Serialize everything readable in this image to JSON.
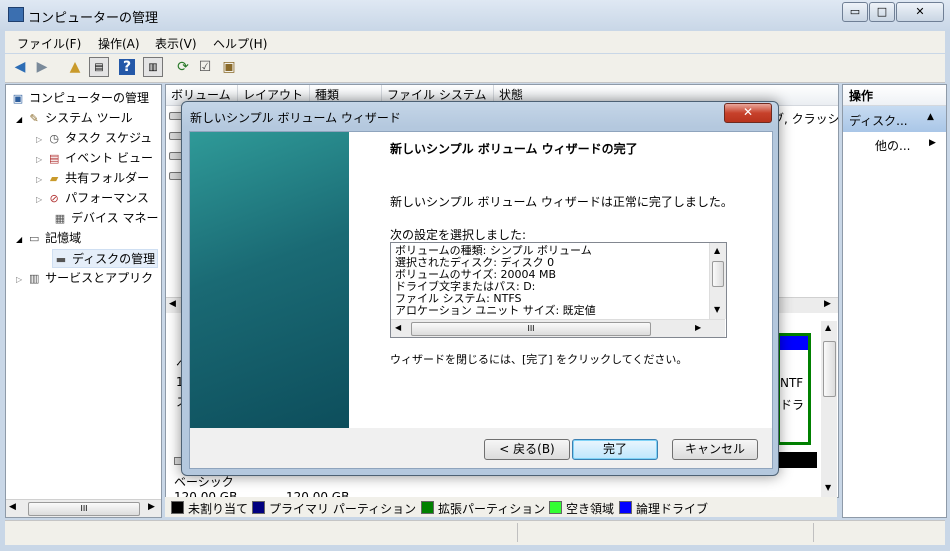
{
  "app": {
    "title": "コンピューターの管理",
    "window_buttons": {
      "minimize": "▭",
      "restore": "□",
      "close": "✕"
    }
  },
  "menu": [
    "ファイル(F)",
    "操作(A)",
    "表示(V)",
    "ヘルプ(H)"
  ],
  "tree": [
    {
      "label": "コンピューターの管理",
      "icon": "computer-icon"
    },
    {
      "label": "システム ツール",
      "icon": "tools-icon"
    },
    {
      "label": "タスク スケジュ",
      "icon": "clock-icon"
    },
    {
      "label": "イベント ビュー",
      "icon": "event-log-icon"
    },
    {
      "label": "共有フォルダー",
      "icon": "shared-folder-icon"
    },
    {
      "label": "パフォーマンス",
      "icon": "performance-icon"
    },
    {
      "label": "デバイス マネー",
      "icon": "device-manager-icon"
    },
    {
      "label": "記憶域",
      "icon": "storage-icon"
    },
    {
      "label": "ディスクの管理",
      "icon": "disk-icon"
    },
    {
      "label": "サービスとアプリク",
      "icon": "services-icon"
    }
  ],
  "center": {
    "columns": [
      "ボリューム",
      "レイアウト",
      "種類",
      "ファイル システム",
      "状態"
    ],
    "row_tail": "ブ, クラッシ",
    "disk_label": "ベーシック",
    "disk_size": "120.00 GB",
    "disk_size2": "120.00 GB",
    "frag_left1": "ヘ",
    "frag_left2": "1",
    "frag_left3": "ス",
    "frag_right1": "NTF",
    "frag_right2": "ドラ"
  },
  "actions": {
    "header": "操作",
    "item": "ディスク...",
    "sub": "他の..."
  },
  "legend": [
    {
      "label": "未割り当て",
      "color": "#000000"
    },
    {
      "label": "プライマリ パーティション",
      "color": "#00007f"
    },
    {
      "label": "拡張パーティション",
      "color": "#008000"
    },
    {
      "label": "空き領域",
      "color": "#33ff33"
    },
    {
      "label": "論理ドライブ",
      "color": "#0000ff"
    }
  ],
  "dialog": {
    "title": "新しいシンプル ボリューム ウィザード",
    "heading": "新しいシンプル ボリューム ウィザードの完了",
    "message": "新しいシンプル ボリューム ウィザードは正常に完了しました。",
    "settings_label": "次の設定を選択しました:",
    "settings": [
      "ボリュームの種類: シンプル ボリューム",
      "選択されたディスク: ディスク 0",
      "ボリュームのサイズ: 20004 MB",
      "ドライブ文字またはパス: D:",
      "ファイル システム: NTFS",
      "アロケーション ユニット サイズ: 既定値"
    ],
    "close_hint": "ウィザードを閉じるには、[完了] をクリックしてください。",
    "back_button": "< 戻る(B)",
    "finish_button": "完了",
    "cancel_button": "キャンセル"
  },
  "colors": {
    "accent": "#3399ff",
    "wizard_side": "#1a6a74"
  }
}
